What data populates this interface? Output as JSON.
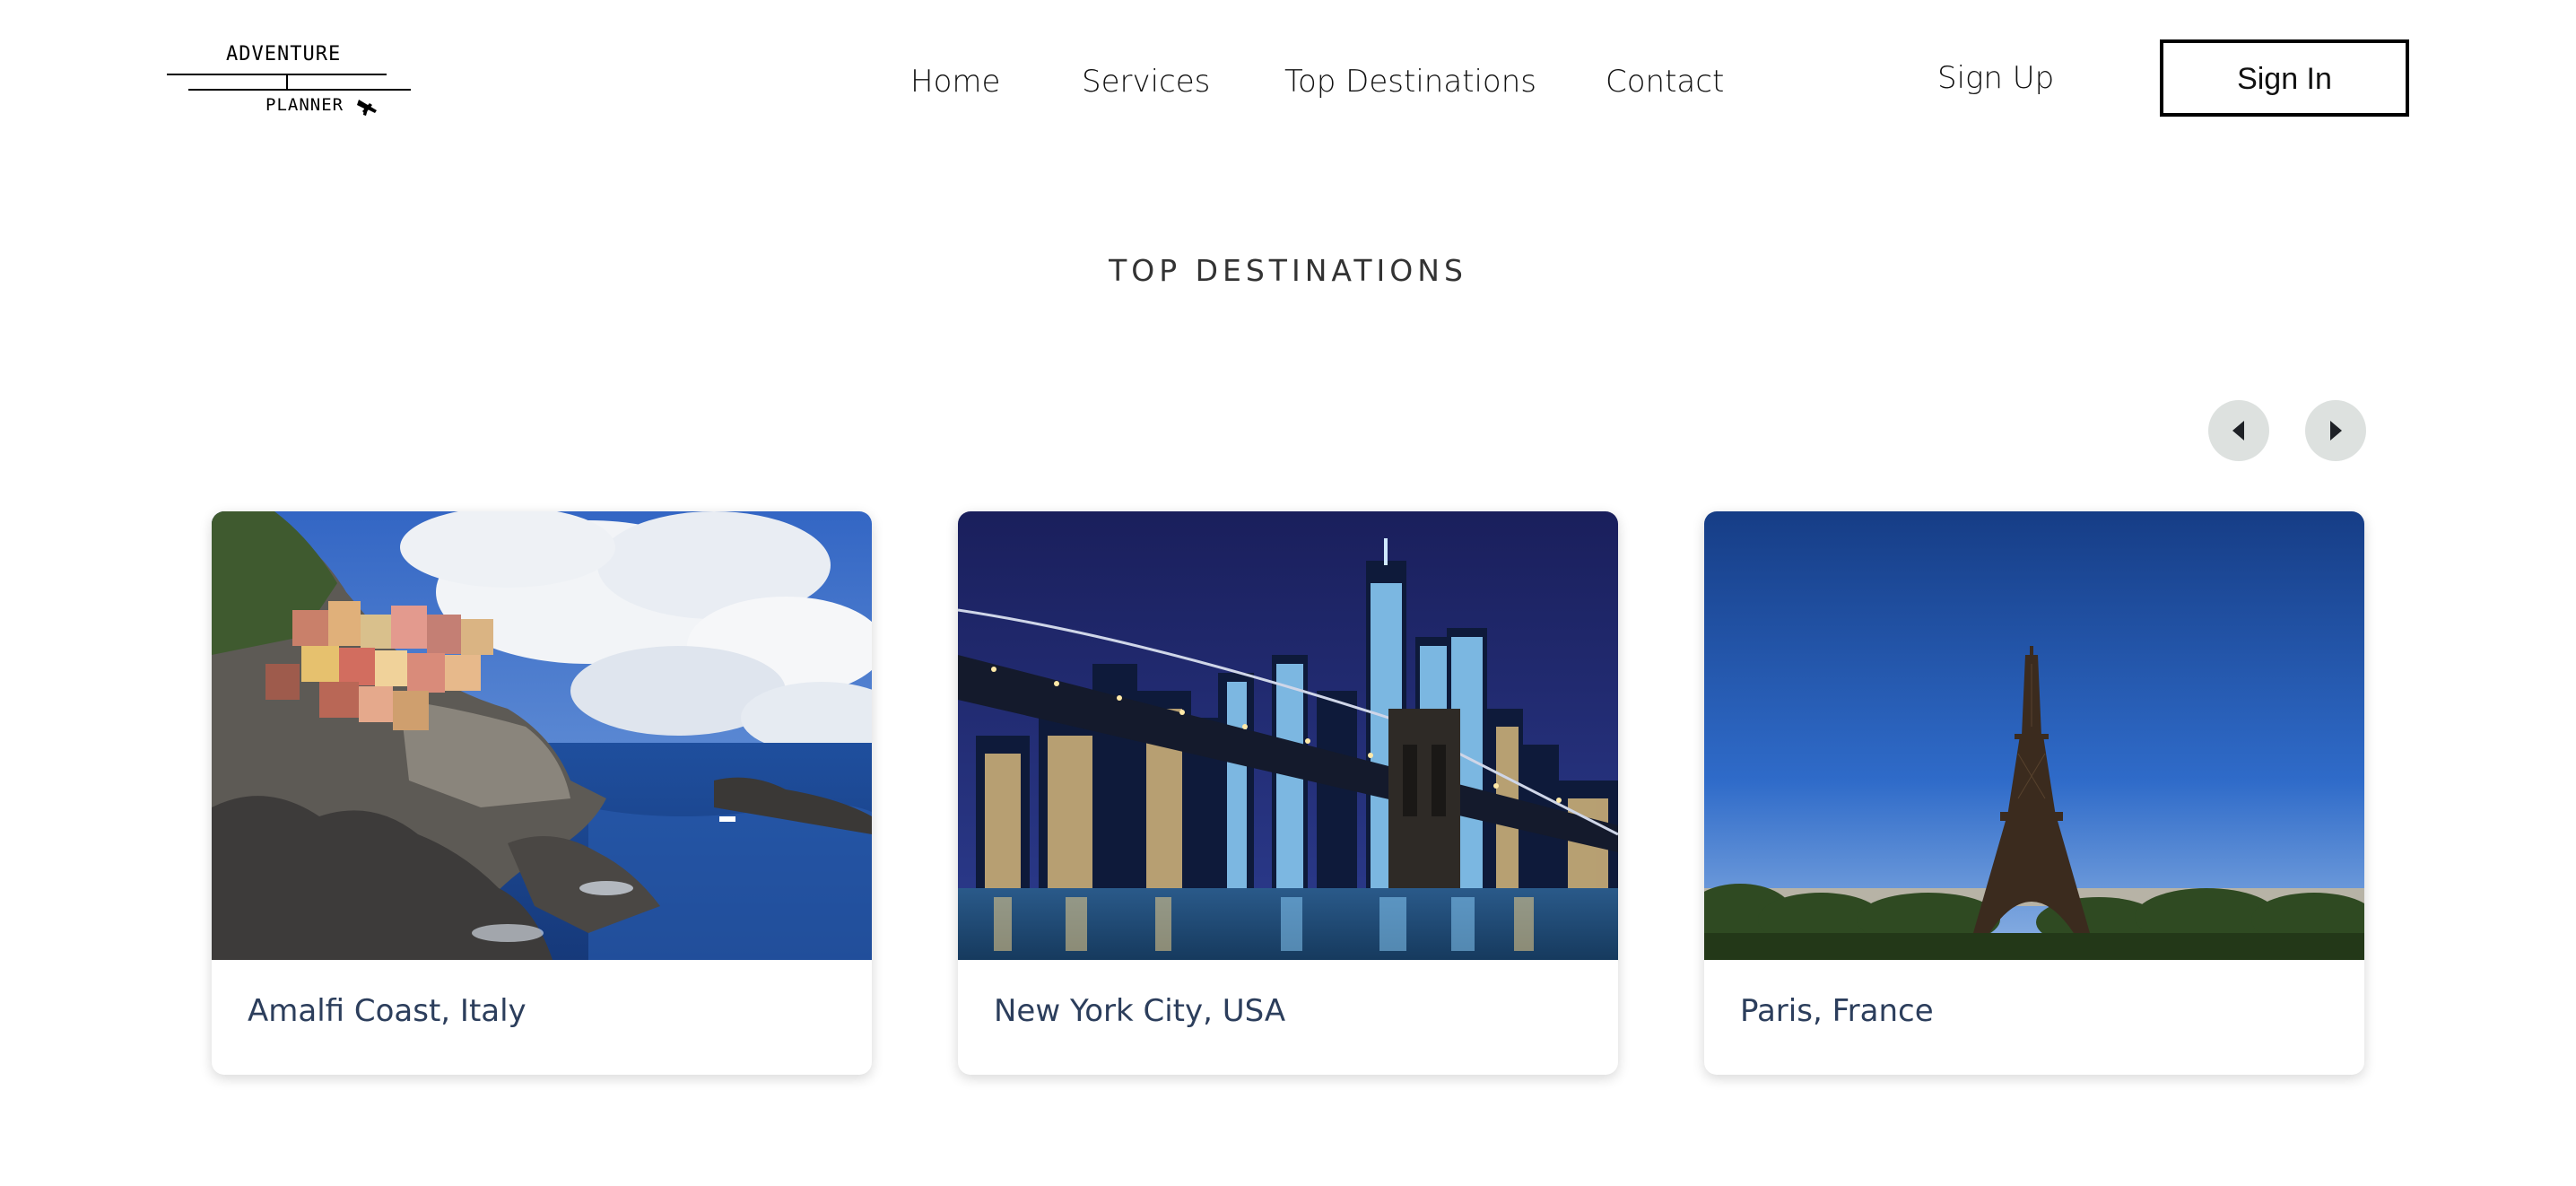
{
  "logo": {
    "top_text": "ADVENTURE",
    "bottom_text": "PLANNER",
    "icon": "airplane-icon"
  },
  "nav": {
    "home": "Home",
    "services": "Services",
    "top_destinations": "Top Destinations",
    "contact": "Contact"
  },
  "auth": {
    "sign_up": "Sign Up",
    "sign_in": "Sign In"
  },
  "section": {
    "title": "TOP DESTINATIONS"
  },
  "carousel": {
    "prev_icon": "chevron-left-icon",
    "next_icon": "chevron-right-icon"
  },
  "destinations": [
    {
      "name": "Amalfi Coast, Italy"
    },
    {
      "name": "New York City, USA"
    },
    {
      "name": "Paris, France"
    }
  ],
  "colors": {
    "card_label": "#2c3e5c",
    "arrow_bg": "#dde1df",
    "sky_blue": "#3f74c9",
    "night_sky": "#1f2a6b",
    "paris_sky": "#1e4fa0"
  }
}
